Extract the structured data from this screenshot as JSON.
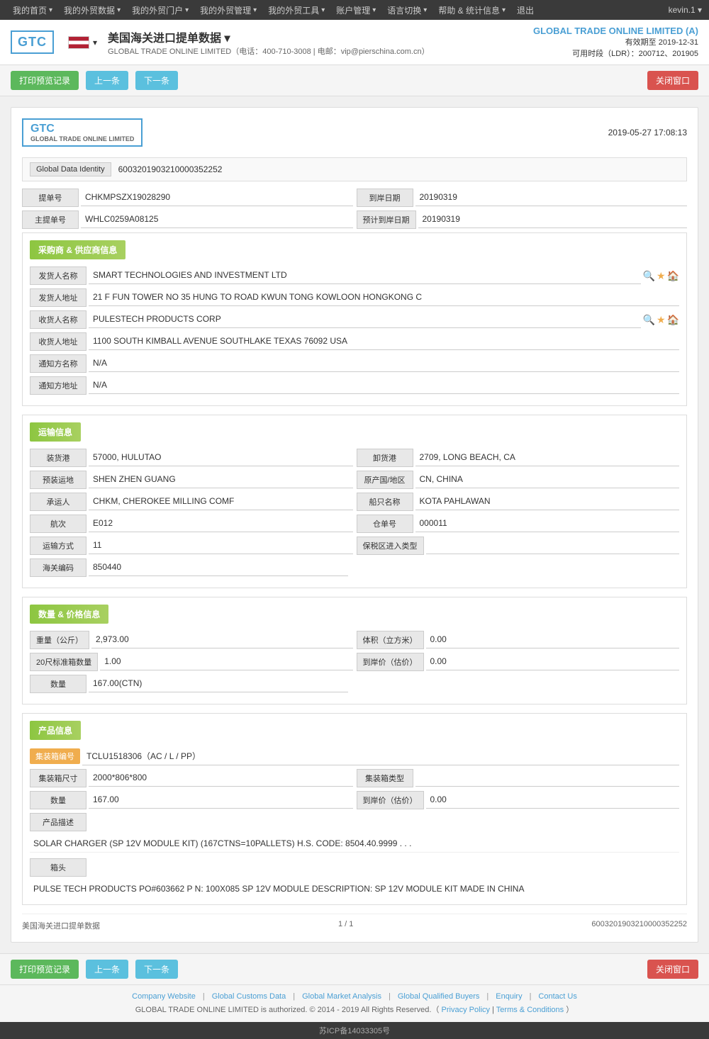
{
  "nav": {
    "items": [
      {
        "label": "我的首页",
        "has_arrow": true
      },
      {
        "label": "我的外贸数据",
        "has_arrow": true
      },
      {
        "label": "我的外贸门户",
        "has_arrow": true
      },
      {
        "label": "我的外贸管理",
        "has_arrow": true
      },
      {
        "label": "我的外贸工具",
        "has_arrow": true
      },
      {
        "label": "账户管理",
        "has_arrow": true
      },
      {
        "label": "语言切换",
        "has_arrow": true
      },
      {
        "label": "帮助 & 统计信息",
        "has_arrow": true
      },
      {
        "label": "退出"
      }
    ],
    "user": "kevin.1 ▾"
  },
  "header": {
    "logo_text": "GTC",
    "logo_sub": "GLOBAL TRADE ONLINE LIMITED",
    "flag_alt": "USA flag",
    "page_title": "美国海关进口提单数据 ▾",
    "page_subtitle": "GLOBAL TRADE ONLINE LIMITED（电话：400-710-3008 | 电邮：vip@pierschina.com.cn）",
    "company": "GLOBAL TRADE ONLINE LIMITED (A)",
    "valid_until": "有效期至 2019-12-31",
    "ldr": "可用时段（LDR）：200712、201905"
  },
  "toolbar": {
    "print_btn": "打印预览记录",
    "prev_btn": "上一条",
    "next_btn": "下一条",
    "close_btn": "关闭窗口"
  },
  "document": {
    "logo_text": "GTC",
    "logo_sub": "GLOBAL TRADE ONLINE LIMITED",
    "timestamp": "2019-05-27 17:08:13",
    "global_data_identity_label": "Global Data Identity",
    "global_data_identity_value": "6003201903210000352252",
    "bill_no_label": "提单号",
    "bill_no_value": "CHKMPSZX19028290",
    "arrival_date_label": "到岸日期",
    "arrival_date_value": "20190319",
    "master_bill_label": "主提单号",
    "master_bill_value": "WHLC0259A08125",
    "planned_arrival_label": "预计到岸日期",
    "planned_arrival_value": "20190319",
    "buyer_supplier_section": "采购商 & 供应商信息",
    "shipper_name_label": "发货人名称",
    "shipper_name_value": "SMART TECHNOLOGIES AND INVESTMENT LTD",
    "shipper_address_label": "发货人地址",
    "shipper_address_value": "21 F FUN TOWER NO 35 HUNG TO ROAD KWUN TONG KOWLOON HONGKONG C",
    "consignee_name_label": "收货人名称",
    "consignee_name_value": "PULESTECH PRODUCTS CORP",
    "consignee_address_label": "收货人地址",
    "consignee_address_value": "1100 SOUTH KIMBALL AVENUE SOUTHLAKE TEXAS 76092 USA",
    "notify_name_label": "通知方名称",
    "notify_name_value": "N/A",
    "notify_address_label": "通知方地址",
    "notify_address_value": "N/A",
    "transport_section": "运输信息",
    "loading_port_label": "装货港",
    "loading_port_value": "57000, HULUTAO",
    "unloading_port_label": "卸货港",
    "unloading_port_value": "2709, LONG BEACH, CA",
    "pre_transport_label": "预装运地",
    "pre_transport_value": "SHEN ZHEN GUANG",
    "origin_country_label": "原产国/地区",
    "origin_country_value": "CN, CHINA",
    "carrier_label": "承运人",
    "carrier_value": "CHKM, CHEROKEE MILLING COMF",
    "vessel_name_label": "船只名称",
    "vessel_name_value": "KOTA PAHLAWAN",
    "voyage_label": "航次",
    "voyage_value": "E012",
    "warehouse_label": "仓单号",
    "warehouse_value": "000011",
    "transport_mode_label": "运输方式",
    "transport_mode_value": "11",
    "bonded_zone_label": "保税区进入类型",
    "bonded_zone_value": "",
    "customs_code_label": "海关编码",
    "customs_code_value": "850440",
    "quantity_section": "数量 & 价格信息",
    "weight_label": "重量（公斤）",
    "weight_value": "2,973.00",
    "volume_label": "体积（立方米）",
    "volume_value": "0.00",
    "containers_20_label": "20尺标准箱数量",
    "containers_20_value": "1.00",
    "landing_price_label": "到岸价（估价）",
    "landing_price_value": "0.00",
    "quantity_label": "数量",
    "quantity_value": "167.00(CTN)",
    "product_section": "产品信息",
    "container_no_label": "集装箱编号",
    "container_no_value": "TCLU1518306（AC / L / PP）",
    "container_size_label": "集装箱尺寸",
    "container_size_value": "2000*806*800",
    "container_type_label": "集装箱类型",
    "container_type_value": "",
    "product_quantity_label": "数量",
    "product_quantity_value": "167.00",
    "product_price_label": "到岸价（估价）",
    "product_price_value": "0.00",
    "product_desc_label": "产品描述",
    "product_desc_value": "SOLAR CHARGER (SP 12V MODULE KIT) (167CTNS=10PALLETS) H.S. CODE: 8504.40.9999 . . .",
    "head_label": "箱头",
    "head_value": "PULSE TECH PRODUCTS PO#603662 P N: 100X085 SP 12V MODULE DESCRIPTION: SP 12V MODULE KIT MADE IN CHINA",
    "footer_left": "美国海关进口提单数据",
    "footer_center": "1 / 1",
    "footer_right": "6003201903210000352252"
  },
  "site_footer": {
    "links": [
      "Company Website",
      "Global Customs Data",
      "Global Market Analysis",
      "Global Qualified Buyers",
      "Enquiry",
      "Contact Us"
    ],
    "copyright": "GLOBAL TRADE ONLINE LIMITED is authorized. © 2014 - 2019 All Rights Reserved.（",
    "privacy": "Privacy Policy",
    "terms": "Terms & Conditions",
    "close_paren": "）"
  },
  "icp": {
    "text": "苏ICP备14033305号"
  }
}
